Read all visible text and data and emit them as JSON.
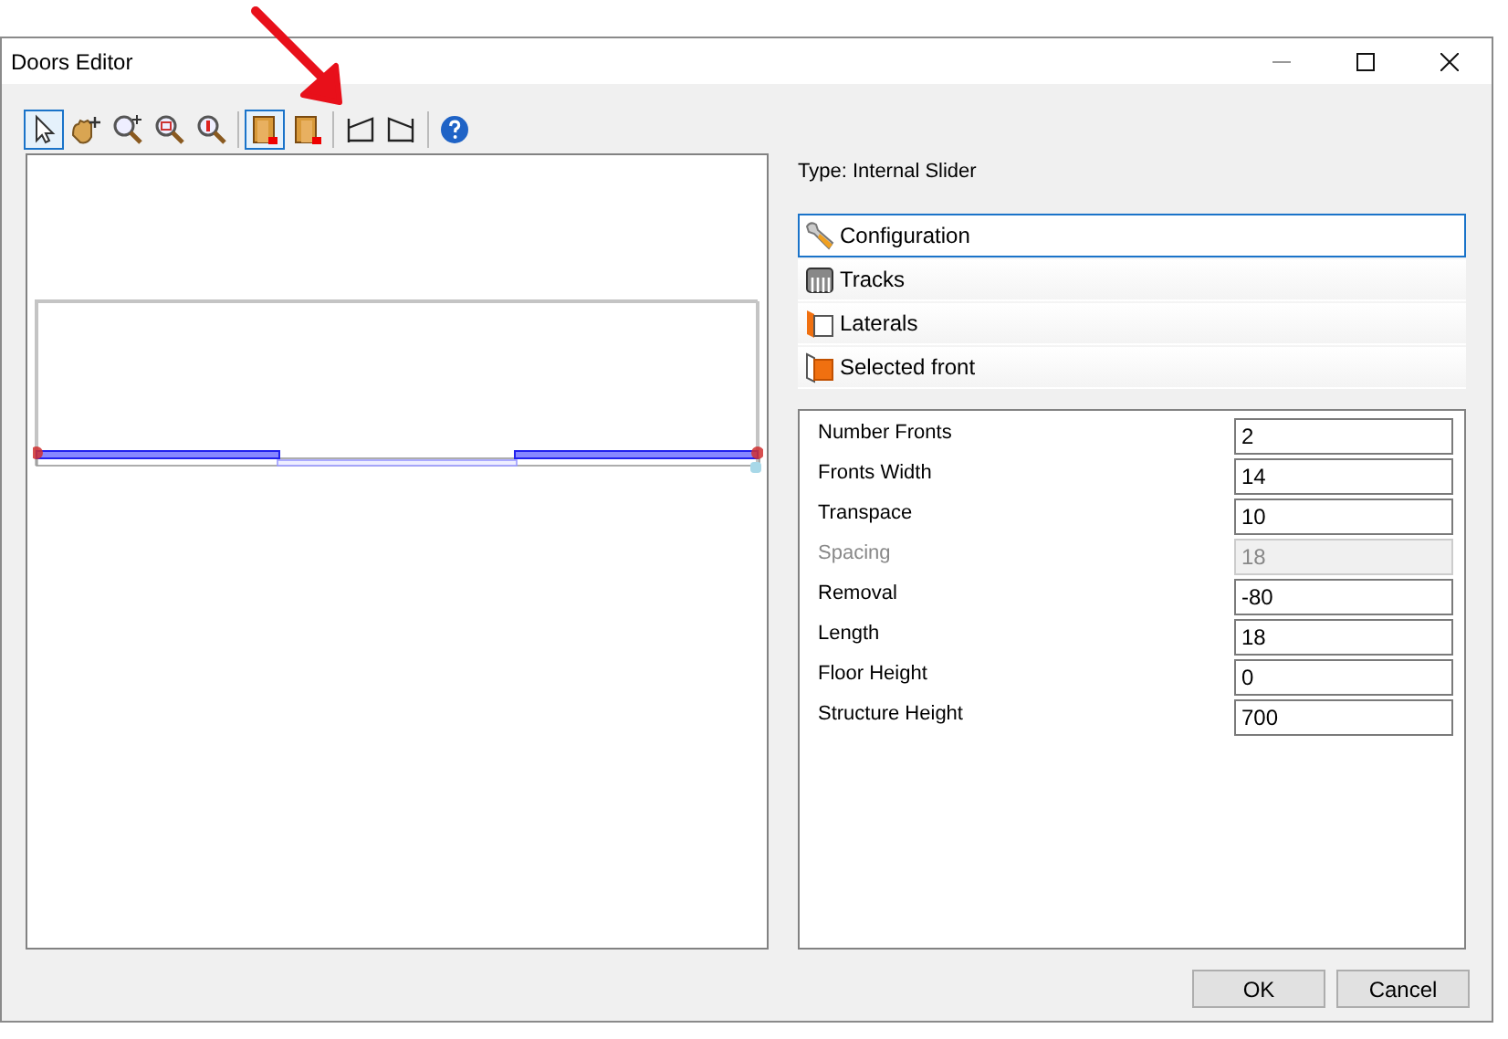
{
  "window": {
    "title": "Doors Editor"
  },
  "toolbar": [
    {
      "kind": "pointer",
      "selected": true
    },
    {
      "kind": "pan",
      "selected": false
    },
    {
      "kind": "zoom-in",
      "selected": false
    },
    {
      "kind": "zoom-fit",
      "selected": false
    },
    {
      "kind": "zoom-reset",
      "selected": false
    },
    {
      "kind": "sep"
    },
    {
      "kind": "door-left",
      "selected": true
    },
    {
      "kind": "door-right",
      "selected": false
    },
    {
      "kind": "sep"
    },
    {
      "kind": "shape-left",
      "selected": false
    },
    {
      "kind": "shape-right",
      "selected": false
    },
    {
      "kind": "sep"
    },
    {
      "kind": "help",
      "selected": false
    }
  ],
  "type_label": "Type: Internal Slider",
  "sections": [
    {
      "kind": "wrench",
      "label": "Configuration",
      "selected": true
    },
    {
      "kind": "tracks",
      "label": "Tracks",
      "selected": false
    },
    {
      "kind": "laterals",
      "label": "Laterals",
      "selected": false
    },
    {
      "kind": "front",
      "label": "Selected front",
      "selected": false
    }
  ],
  "properties": [
    {
      "label": "Number Fronts",
      "value": "2",
      "disabled": false
    },
    {
      "label": "Fronts Width",
      "value": "14",
      "disabled": false
    },
    {
      "label": "Transpace",
      "value": "10",
      "disabled": false
    },
    {
      "label": "Spacing",
      "value": "18",
      "disabled": true
    },
    {
      "label": "Removal",
      "value": "-80",
      "disabled": false
    },
    {
      "label": "Length",
      "value": "18",
      "disabled": false
    },
    {
      "label": "Floor Height",
      "value": "0",
      "disabled": false
    },
    {
      "label": "Structure Height",
      "value": "700",
      "disabled": false
    }
  ],
  "buttons": [
    "OK",
    "Cancel"
  ]
}
